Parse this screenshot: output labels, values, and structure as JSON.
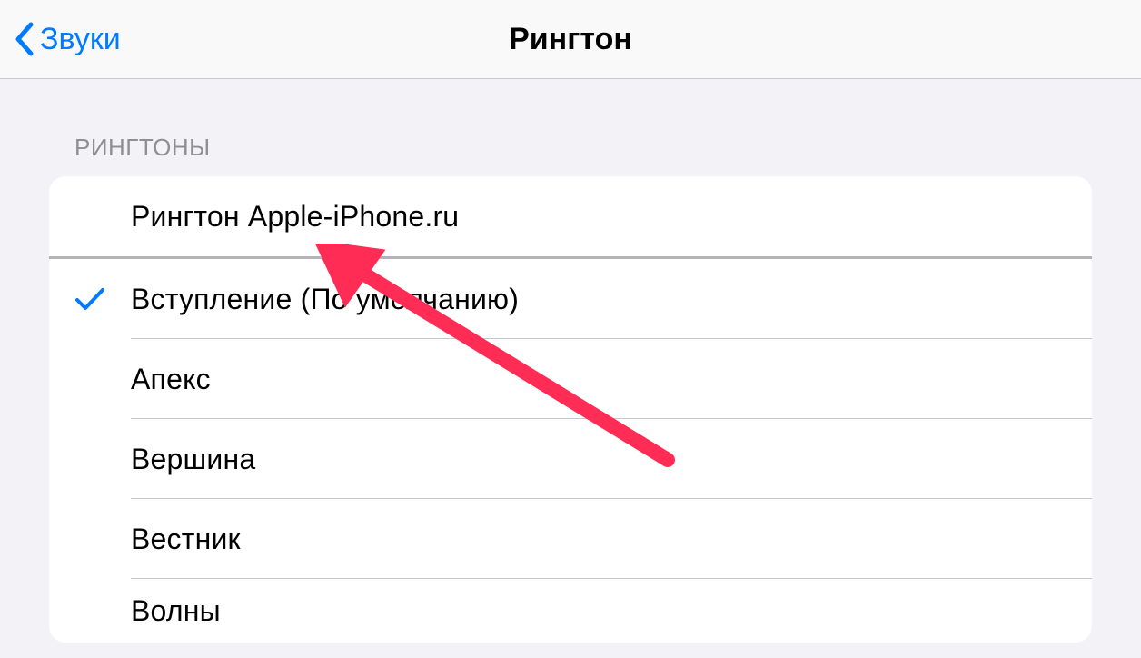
{
  "nav": {
    "back_label": "Звуки",
    "title": "Рингтон"
  },
  "section": {
    "header": "РИНГТОНЫ"
  },
  "ringtones": {
    "custom": [
      {
        "label": "Рингтон Apple-iPhone.ru",
        "selected": false
      }
    ],
    "builtin": [
      {
        "label": "Вступление (По умолчанию)",
        "selected": true
      },
      {
        "label": "Апекс",
        "selected": false
      },
      {
        "label": "Вершина",
        "selected": false
      },
      {
        "label": "Вестник",
        "selected": false
      },
      {
        "label": "Волны",
        "selected": false
      }
    ]
  },
  "colors": {
    "accent": "#007aff",
    "annotation": "#ff2d55"
  }
}
